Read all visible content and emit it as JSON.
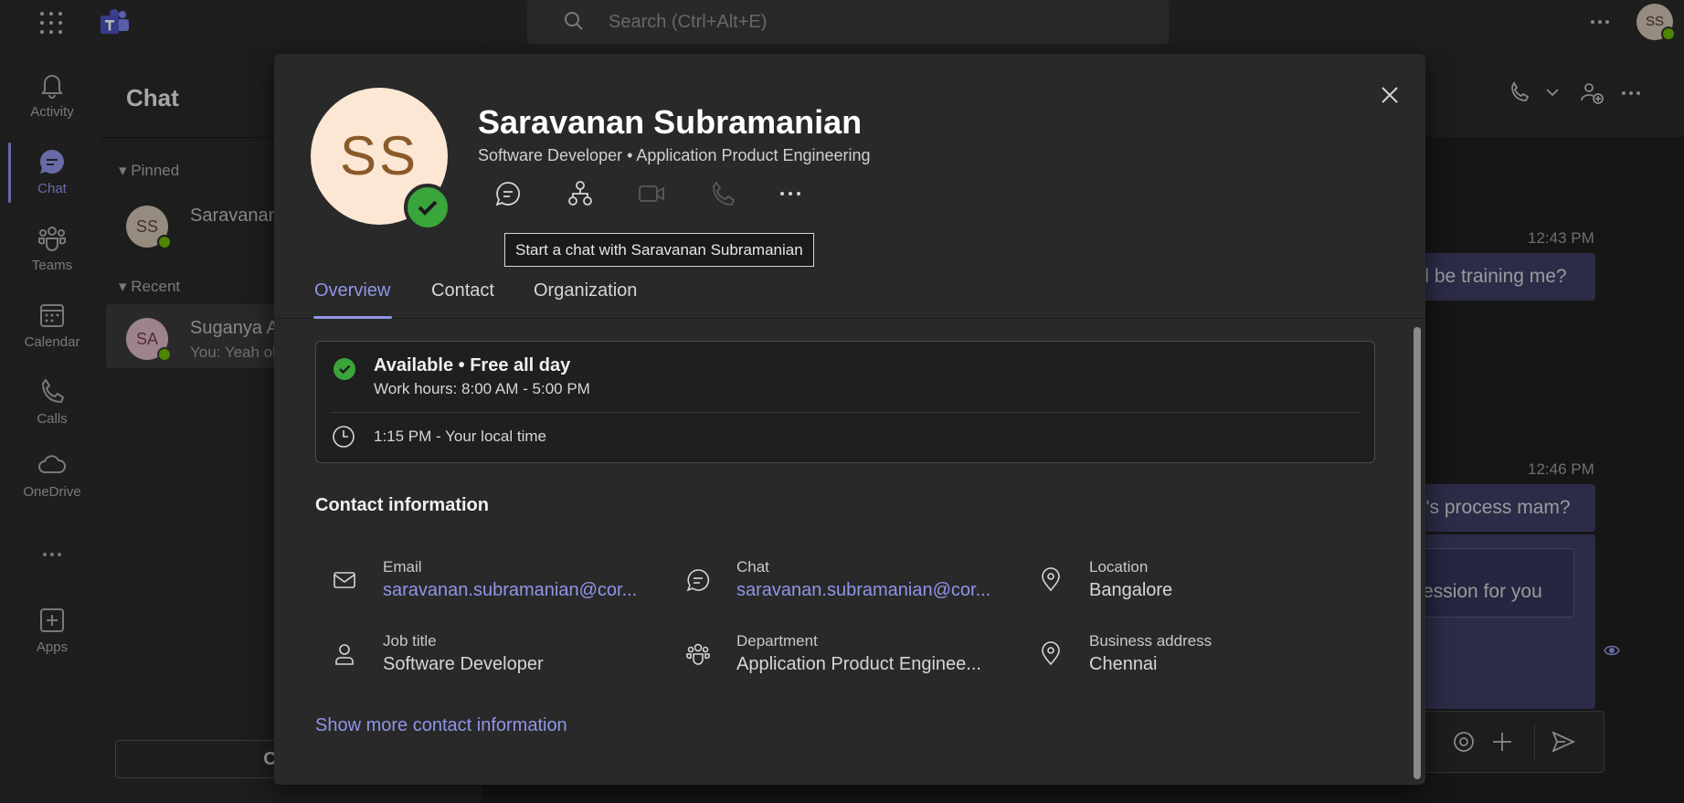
{
  "topbar": {
    "search_placeholder": "Search (Ctrl+Alt+E)",
    "avatar_initials": "SS"
  },
  "rail": {
    "items": [
      {
        "label": "Activity",
        "icon": "bell-icon"
      },
      {
        "label": "Chat",
        "icon": "chat-icon"
      },
      {
        "label": "Teams",
        "icon": "teams-icon"
      },
      {
        "label": "Calendar",
        "icon": "calendar-icon"
      },
      {
        "label": "Calls",
        "icon": "phone-icon"
      },
      {
        "label": "OneDrive",
        "icon": "cloud-icon"
      },
      {
        "label": "Apps",
        "icon": "add-app-icon"
      }
    ]
  },
  "chatlist": {
    "title": "Chat",
    "pinned_label": "Pinned",
    "recent_label": "Recent",
    "pinned_item": {
      "initials": "SS",
      "name": "Saravanan"
    },
    "recent_item": {
      "initials": "SA",
      "name": "Suganya A",
      "preview": "You: Yeah ok"
    },
    "chat_with_button": "Chat w"
  },
  "conversation": {
    "timestamps": [
      "12:43 PM",
      "12:46 PM"
    ],
    "messages": [
      "ill be training me?",
      "y's process mam?",
      "g session for you"
    ]
  },
  "profile": {
    "initials": "SS",
    "name": "Saravanan Subramanian",
    "subtitle": "Software Developer • Application Product Engineering",
    "tooltip": "Start a chat with Saravanan Subramanian",
    "tabs": [
      "Overview",
      "Contact",
      "Organization"
    ],
    "availability": {
      "status": "Available • Free all day",
      "work_hours": "Work hours: 8:00 AM - 5:00 PM",
      "local_time": "1:15 PM - Your local time"
    },
    "contact_heading": "Contact information",
    "contact": [
      {
        "label": "Email",
        "value": "saravanan.subramanian@cor...",
        "icon": "mail-icon",
        "link": true
      },
      {
        "label": "Chat",
        "value": "saravanan.subramanian@cor...",
        "icon": "chat-icon",
        "link": true
      },
      {
        "label": "Location",
        "value": "Bangalore",
        "icon": "location-icon",
        "link": false
      },
      {
        "label": "Job title",
        "value": "Software Developer",
        "icon": "person-icon",
        "link": false
      },
      {
        "label": "Department",
        "value": "Application Product Enginee...",
        "icon": "people-icon",
        "link": false
      },
      {
        "label": "Business address",
        "value": "Chennai",
        "icon": "location-icon",
        "link": false
      }
    ],
    "show_more": "Show more contact information"
  },
  "colors": {
    "accent": "#8f95e8",
    "presence_available": "#3aa53a"
  }
}
